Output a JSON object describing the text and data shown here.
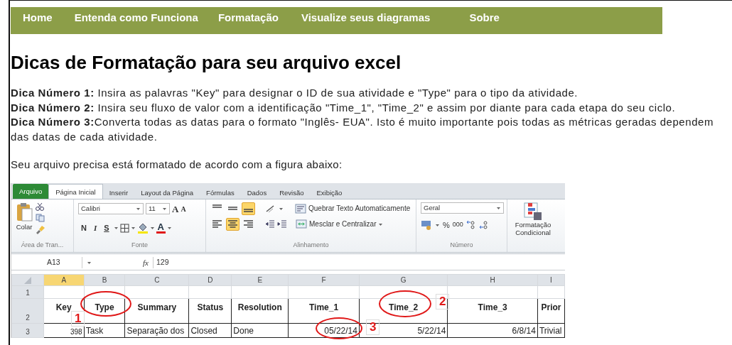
{
  "nav": {
    "items": [
      {
        "label": "Home"
      },
      {
        "label": "Entenda como Funciona"
      },
      {
        "label": "Formatação"
      },
      {
        "label": "Visualize seus diagramas"
      },
      {
        "label": "Sobre"
      }
    ]
  },
  "heading": "Dicas de Formatação para seu arquivo excel",
  "tips": [
    "**Dica Número 1:** Insira as palavras \"Key\" para designar o ID de sua atividade e \"Type\" para o tipo da atividade.",
    "**Dica Número 2:** Insira seu fluxo de valor com a identificação \"Time_1\", \"Time_2\" e assim por diante para cada etapa do seu ciclo.",
    "**Dica Número 3:**Converta todas as datas para o formato \"Inglês- EUA\". Isto é muito importante pois todas as métricas geradas dependem das datas de cada atividade."
  ],
  "note": "Seu arquivo precisa está formatado de acordo com a figura abaixo:",
  "excel": {
    "tabs": [
      {
        "label": "Arquivo",
        "kind": "file",
        "selected": false
      },
      {
        "label": "Página Inicial",
        "kind": "tab",
        "selected": true
      },
      {
        "label": "Inserir",
        "kind": "tab",
        "selected": false
      },
      {
        "label": "Layout da Página",
        "kind": "tab",
        "selected": false
      },
      {
        "label": "Fórmulas",
        "kind": "tab",
        "selected": false
      },
      {
        "label": "Dados",
        "kind": "tab",
        "selected": false
      },
      {
        "label": "Revisão",
        "kind": "tab",
        "selected": false
      },
      {
        "label": "Exibição",
        "kind": "tab",
        "selected": false
      }
    ],
    "ribbon": {
      "paste_label": "Colar",
      "clipboard_group": "Área de Tran...",
      "font_name": "Calibri",
      "font_size": "11",
      "grow": "A",
      "shrink": "A",
      "bold": "N",
      "italic": "I",
      "underline": "S",
      "font_color": "A",
      "font_group": "Fonte",
      "align_top": [
        {
          "kind": "top",
          "selected": false
        },
        {
          "kind": "middle",
          "selected": false
        },
        {
          "kind": "bottom",
          "selected": true
        }
      ],
      "align_bottom": [
        {
          "kind": "left",
          "selected": false
        },
        {
          "kind": "center",
          "selected": true
        },
        {
          "kind": "right",
          "selected": false
        }
      ],
      "wrap_text": "Quebrar Texto Automaticamente",
      "merge": "Mesclar e Centralizar",
      "alignment_group": "Alinhamento",
      "number_format": "Geral",
      "percent": "%",
      "thousands": "000",
      "number_group": "Número",
      "conditional": "Formatação Condicional"
    },
    "name_box": "A13",
    "function_label": "fx",
    "formula": "129",
    "columns": [
      {
        "label": "A",
        "selected": true
      },
      {
        "label": "B",
        "selected": false
      },
      {
        "label": "C",
        "selected": false
      },
      {
        "label": "D",
        "selected": false
      },
      {
        "label": "E",
        "selected": false
      },
      {
        "label": "F",
        "selected": false
      },
      {
        "label": "G",
        "selected": false
      },
      {
        "label": "H",
        "selected": false
      },
      {
        "label": "I",
        "selected": false
      }
    ],
    "rows": [
      {
        "number": "1",
        "kind": "blank",
        "cells": []
      },
      {
        "number": "2",
        "kind": "header",
        "cells": [
          "Key",
          "Type",
          "Summary",
          "Status",
          "Resolution",
          "Time_1",
          "Time_2",
          "Time_3",
          "Prior"
        ]
      },
      {
        "number": "3",
        "kind": "data",
        "cells": [
          "398",
          "Task",
          "Separação dos",
          "Closed",
          "Done",
          "05/22/14",
          "5/22/14",
          "6/8/14",
          "Trivial"
        ]
      }
    ],
    "annotations": [
      {
        "number": "1"
      },
      {
        "number": "2"
      },
      {
        "number": "3"
      }
    ]
  }
}
